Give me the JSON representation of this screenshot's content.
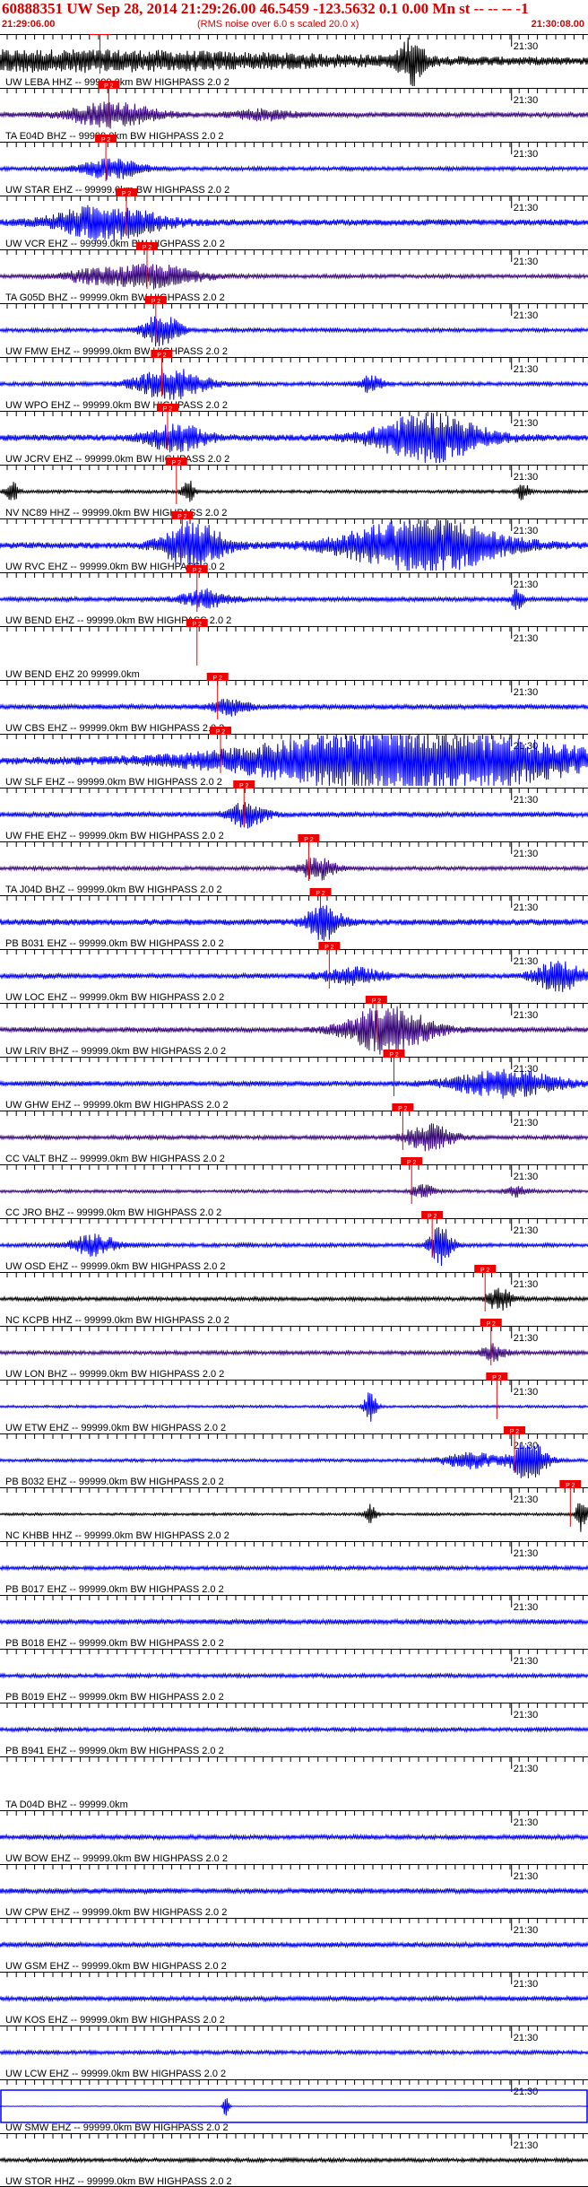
{
  "header": {
    "title": "60888351 UW Sep 28, 2014 21:29:26.00   46.5459 -123.5632  0.1 0.00 Mn st -- -- --  -1",
    "start_time": "21:29:06.00",
    "scale_note": "(RMS noise over 6.0 s scaled 20.0 x)",
    "end_time": "21:30:08.00"
  },
  "colors": {
    "black": "#000000",
    "blue": "#0000ff",
    "purple": "#3a0a7a",
    "pick": "#ee0000",
    "pick_text": "#ffffff",
    "label": "#000000"
  },
  "chart_data": {
    "type": "line",
    "title": "60888351 UW Sep 28, 2014 21:29:26.00   46.5459 -123.5632  0.1 0.00 Mn st -- -- --  -1",
    "x_start": "21:29:06.00",
    "x_end": "21:30:08.00",
    "minute_tick_label": "21:30",
    "pick_label": "P 2",
    "series": [
      {
        "name": "UW LEBA HHZ -- 99999.0km BW HIGHPASS 2.0 2",
        "color": "black",
        "pick_frac": 0.17,
        "amp": 0.25,
        "bursts": [
          [
            0.1,
            0.55,
            0.7
          ],
          [
            0.7,
            0.02,
            1.8
          ]
        ]
      },
      {
        "name": "TA E04D BHZ -- 99999.0km BW HIGHPASS 2.0 2",
        "color": "purple",
        "pick_frac": 0.185,
        "amp": 0.2,
        "bursts": [
          [
            0.19,
            0.07,
            1.0
          ],
          [
            0.45,
            0.05,
            0.35
          ]
        ]
      },
      {
        "name": "UW STAR EHZ -- 99999.0km BW HIGHPASS 2.0 2",
        "color": "blue",
        "pick_frac": 0.18,
        "amp": 0.15,
        "bursts": [
          [
            0.19,
            0.05,
            0.8
          ]
        ]
      },
      {
        "name": "UW VCR EHZ -- 99999.0km BW HIGHPASS 2.0 2",
        "color": "blue",
        "pick_frac": 0.215,
        "amp": 0.25,
        "bursts": [
          [
            0.18,
            0.09,
            1.3
          ]
        ]
      },
      {
        "name": "TA G05D BHZ -- 99999.0km BW HIGHPASS 2.0 2",
        "color": "purple",
        "pick_frac": 0.25,
        "amp": 0.15,
        "bursts": [
          [
            0.26,
            0.08,
            0.9
          ],
          [
            0.15,
            0.05,
            0.4
          ]
        ]
      },
      {
        "name": "UW FMW EHZ -- 99999.0km BW HIGHPASS 2.0 2",
        "color": "blue",
        "pick_frac": 0.265,
        "amp": 0.15,
        "bursts": [
          [
            0.275,
            0.03,
            1.3
          ]
        ]
      },
      {
        "name": "UW WPO EHZ -- 99999.0km BW HIGHPASS 2.0 2",
        "color": "blue",
        "pick_frac": 0.275,
        "amp": 0.15,
        "bursts": [
          [
            0.29,
            0.06,
            1.2
          ],
          [
            0.63,
            0.02,
            0.7
          ]
        ]
      },
      {
        "name": "UW JCRV EHZ -- 99999.0km BW HIGHPASS 2.0 2",
        "color": "blue",
        "pick_frac": 0.285,
        "amp": 0.25,
        "bursts": [
          [
            0.3,
            0.05,
            1.0
          ],
          [
            0.73,
            0.09,
            1.9
          ]
        ]
      },
      {
        "name": "NV NC89 HHZ -- 99999.0km BW HIGHPASS 2.0 2",
        "color": "black",
        "pick_frac": 0.3,
        "amp": 0.12,
        "bursts": [
          [
            0.02,
            0.01,
            0.9
          ],
          [
            0.32,
            0.01,
            1.0
          ],
          [
            0.89,
            0.01,
            0.7
          ]
        ]
      },
      {
        "name": "UW RVC EHZ -- 99999.0km BW HIGHPASS 2.0 2",
        "color": "blue",
        "pick_frac": 0.31,
        "amp": 0.25,
        "bursts": [
          [
            0.33,
            0.05,
            1.9
          ],
          [
            0.72,
            0.13,
            2.2
          ]
        ]
      },
      {
        "name": "UW BEND EHZ -- 99999.0km BW HIGHPASS 2.0 2",
        "color": "blue",
        "pick_frac": 0.335,
        "amp": 0.18,
        "bursts": [
          [
            0.35,
            0.04,
            0.7
          ],
          [
            0.88,
            0.01,
            0.8
          ]
        ]
      },
      {
        "name": "UW BEND EHZ 20 99999.0km",
        "color": "blue",
        "pick_frac": 0.335,
        "amp": 0.0,
        "bursts": []
      },
      {
        "name": "UW CBS EHZ -- 99999.0km BW HIGHPASS 2.0 2",
        "color": "blue",
        "pick_frac": 0.37,
        "amp": 0.2,
        "bursts": [
          [
            0.39,
            0.03,
            0.6
          ]
        ]
      },
      {
        "name": "UW SLF EHZ -- 99999.0km BW HIGHPASS 2.0 2",
        "color": "blue",
        "pick_frac": 0.375,
        "amp": 0.3,
        "bursts": [
          [
            0.7,
            0.28,
            2.5
          ]
        ]
      },
      {
        "name": "UW FHE EHZ -- 99999.0km BW HIGHPASS 2.0 2",
        "color": "blue",
        "pick_frac": 0.415,
        "amp": 0.2,
        "bursts": [
          [
            0.42,
            0.03,
            1.0
          ]
        ]
      },
      {
        "name": "TA J04D BHZ -- 99999.0km BW HIGHPASS 2.0 2",
        "color": "purple",
        "pick_frac": 0.525,
        "amp": 0.15,
        "bursts": [
          [
            0.54,
            0.03,
            0.9
          ]
        ]
      },
      {
        "name": "PB B031 EHZ -- 99999.0km BW HIGHPASS 2.0 2",
        "color": "blue",
        "pick_frac": 0.545,
        "amp": 0.25,
        "bursts": [
          [
            0.55,
            0.03,
            1.3
          ]
        ]
      },
      {
        "name": "UW LOC EHZ -- 99999.0km BW HIGHPASS 2.0 2",
        "color": "blue",
        "pick_frac": 0.56,
        "amp": 0.2,
        "bursts": [
          [
            0.6,
            0.05,
            0.6
          ],
          [
            0.95,
            0.04,
            1.2
          ]
        ]
      },
      {
        "name": "UW LRIV BHZ -- 99999.0km BW HIGHPASS 2.0 2",
        "color": "purple",
        "pick_frac": 0.64,
        "amp": 0.2,
        "bursts": [
          [
            0.66,
            0.07,
            1.9
          ]
        ]
      },
      {
        "name": "UW GHW EHZ -- 99999.0km BW HIGHPASS 2.0 2",
        "color": "blue",
        "pick_frac": 0.67,
        "amp": 0.2,
        "bursts": [
          [
            0.86,
            0.09,
            1.0
          ]
        ]
      },
      {
        "name": "CC VALT BHZ -- 99999.0km BW HIGHPASS 2.0 2",
        "color": "purple",
        "pick_frac": 0.685,
        "amp": 0.15,
        "bursts": [
          [
            0.73,
            0.04,
            1.1
          ]
        ]
      },
      {
        "name": "CC JRO BHZ -- 99999.0km BW HIGHPASS 2.0 2",
        "color": "purple",
        "pick_frac": 0.7,
        "amp": 0.12,
        "bursts": [
          [
            0.72,
            0.02,
            0.5
          ],
          [
            0.88,
            0.02,
            0.4
          ]
        ]
      },
      {
        "name": "UW OSD EHZ -- 99999.0km BW HIGHPASS 2.0 2",
        "color": "blue",
        "pick_frac": 0.735,
        "amp": 0.15,
        "bursts": [
          [
            0.75,
            0.02,
            1.5
          ],
          [
            0.16,
            0.04,
            0.8
          ]
        ]
      },
      {
        "name": "NC KCPB HHZ -- 99999.0km BW HIGHPASS 2.0 2",
        "color": "black",
        "pick_frac": 0.825,
        "amp": 0.15,
        "bursts": [
          [
            0.85,
            0.02,
            1.0
          ]
        ]
      },
      {
        "name": "UW LON BHZ -- 99999.0km BW HIGHPASS 2.0 2",
        "color": "purple",
        "pick_frac": 0.835,
        "amp": 0.15,
        "bursts": [
          [
            0.84,
            0.02,
            0.7
          ]
        ]
      },
      {
        "name": "UW ETW EHZ -- 99999.0km BW HIGHPASS 2.0 2",
        "color": "blue",
        "pick_frac": 0.845,
        "amp": 0.1,
        "bursts": [
          [
            0.63,
            0.01,
            1.3
          ]
        ]
      },
      {
        "name": "PB B032 EHZ -- 99999.0km BW HIGHPASS 2.0 2",
        "color": "blue",
        "pick_frac": 0.875,
        "amp": 0.12,
        "bursts": [
          [
            0.9,
            0.03,
            1.6
          ],
          [
            0.8,
            0.05,
            0.6
          ]
        ]
      },
      {
        "name": "NC KHBB HHZ -- 99999.0km BW HIGHPASS 2.0 2",
        "color": "black",
        "pick_frac": 0.97,
        "amp": 0.1,
        "bursts": [
          [
            0.63,
            0.01,
            0.8
          ],
          [
            0.99,
            0.01,
            1.4
          ]
        ]
      },
      {
        "name": "PB B017 EHZ -- 99999.0km BW HIGHPASS 2.0 2",
        "color": "blue",
        "pick_frac": null,
        "amp": 0.15,
        "bursts": []
      },
      {
        "name": "PB B018 EHZ -- 99999.0km BW HIGHPASS 2.0 2",
        "color": "blue",
        "pick_frac": null,
        "amp": 0.2,
        "bursts": []
      },
      {
        "name": "PB B019 EHZ -- 99999.0km BW HIGHPASS 2.0 2",
        "color": "blue",
        "pick_frac": null,
        "amp": 0.15,
        "bursts": []
      },
      {
        "name": "PB B941 EHZ -- 99999.0km BW HIGHPASS 2.0 2",
        "color": "blue",
        "pick_frac": null,
        "amp": 0.15,
        "bursts": []
      },
      {
        "name": "TA D04D BHZ -- 99999.0km",
        "color": "black",
        "pick_frac": null,
        "amp": 0.0,
        "bursts": []
      },
      {
        "name": "UW BOW EHZ -- 99999.0km BW HIGHPASS 2.0 2",
        "color": "blue",
        "pick_frac": null,
        "amp": 0.18,
        "bursts": []
      },
      {
        "name": "UW CPW EHZ -- 99999.0km BW HIGHPASS 2.0 2",
        "color": "blue",
        "pick_frac": null,
        "amp": 0.2,
        "bursts": []
      },
      {
        "name": "UW GSM EHZ -- 99999.0km BW HIGHPASS 2.0 2",
        "color": "blue",
        "pick_frac": null,
        "amp": 0.2,
        "bursts": []
      },
      {
        "name": "UW KOS EHZ -- 99999.0km BW HIGHPASS 2.0 2",
        "color": "blue",
        "pick_frac": null,
        "amp": 0.18,
        "bursts": []
      },
      {
        "name": "UW LCW EHZ -- 99999.0km BW HIGHPASS 2.0 2",
        "color": "blue",
        "pick_frac": null,
        "amp": 0.15,
        "bursts": []
      },
      {
        "name": "UW SMW EHZ -- 99999.0km BW HIGHPASS 2.0 2",
        "color": "blue",
        "pick_frac": null,
        "amp": 0.02,
        "bursts": [
          [
            0.385,
            0.005,
            1.0
          ]
        ],
        "frame": true
      },
      {
        "name": "UW STOR HHZ -- 99999.0km BW HIGHPASS 2.0 2",
        "color": "black",
        "pick_frac": null,
        "amp": 0.15,
        "bursts": []
      }
    ]
  }
}
